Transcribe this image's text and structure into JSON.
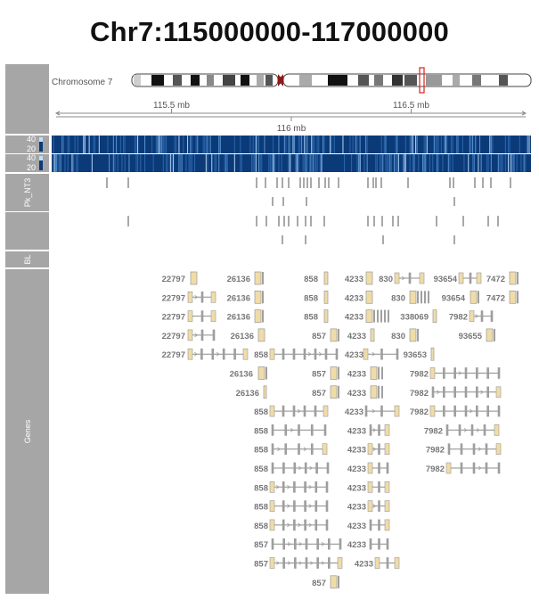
{
  "title": "Chr7:115000000-117000000",
  "ideogram": {
    "label": "Chromosome 7"
  },
  "axis": {
    "ticks_top": [
      {
        "pos_mb": 115.5,
        "label": "115.5 mb"
      },
      {
        "pos_mb": 116.5,
        "label": "116.5 mb"
      }
    ],
    "ticks_bottom": [
      {
        "pos_mb": 116.0,
        "label": "116 mb"
      }
    ]
  },
  "tracks": {
    "signal1": {
      "ymax": "40",
      "ymin": "20"
    },
    "signal2": {
      "ymax": "40",
      "ymin": "20"
    },
    "pk_label": "Pk_NT3",
    "bl_label": "BL",
    "genes_label": "Genes"
  },
  "colors": {
    "sidebar": "#a6a6a6",
    "heat_dark": "#0b3a78",
    "heat_light": "#9ac8f0",
    "peak": "#a9a9a9",
    "gene_box": "#f0dca8",
    "gene_line": "#8c8c8c",
    "highlight": "#e0302a"
  },
  "gene_labels": [
    [
      "22797",
      "26136",
      "858",
      "4233",
      "830",
      "93654",
      "7472"
    ],
    [
      "22797",
      "26136",
      "858",
      "4233",
      "830",
      "93654",
      "7472"
    ],
    [
      "22797",
      "26136",
      "858",
      "4233",
      "338069",
      "7982"
    ],
    [
      "22797",
      "26136",
      "857",
      "4233",
      "830",
      "93655"
    ],
    [
      "22797",
      "858",
      "4233",
      "93653"
    ],
    [
      "26136",
      "857",
      "4233",
      "7982"
    ],
    [
      "26136",
      "857",
      "4233",
      "7982"
    ],
    [
      "858",
      "4233",
      "7982"
    ],
    [
      "858",
      "4233",
      "7982"
    ],
    [
      "858",
      "4233",
      "7982"
    ],
    [
      "858",
      "4233",
      "7982"
    ],
    [
      "858",
      "4233"
    ],
    [
      "858",
      "4233"
    ],
    [
      "858",
      "4233"
    ],
    [
      "857",
      "4233"
    ],
    [
      "857",
      "4233"
    ],
    [
      "857"
    ]
  ]
}
